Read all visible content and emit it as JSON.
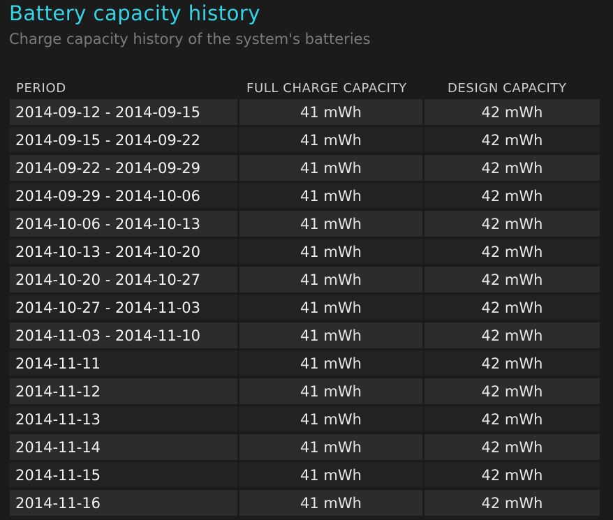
{
  "title": "Battery capacity history",
  "subtitle": "Charge capacity history of the system's batteries",
  "columns": {
    "period": "PERIOD",
    "full_charge_capacity": "FULL CHARGE CAPACITY",
    "design_capacity": "DESIGN CAPACITY"
  },
  "rows": [
    {
      "period": "2014-09-12 - 2014-09-15",
      "full": "41 mWh",
      "design": "42 mWh"
    },
    {
      "period": "2014-09-15 - 2014-09-22",
      "full": "41 mWh",
      "design": "42 mWh"
    },
    {
      "period": "2014-09-22 - 2014-09-29",
      "full": "41 mWh",
      "design": "42 mWh"
    },
    {
      "period": "2014-09-29 - 2014-10-06",
      "full": "41 mWh",
      "design": "42 mWh"
    },
    {
      "period": "2014-10-06 - 2014-10-13",
      "full": "41 mWh",
      "design": "42 mWh"
    },
    {
      "period": "2014-10-13 - 2014-10-20",
      "full": "41 mWh",
      "design": "42 mWh"
    },
    {
      "period": "2014-10-20 - 2014-10-27",
      "full": "41 mWh",
      "design": "42 mWh"
    },
    {
      "period": "2014-10-27 - 2014-11-03",
      "full": "41 mWh",
      "design": "42 mWh"
    },
    {
      "period": "2014-11-03 - 2014-11-10",
      "full": "41 mWh",
      "design": "42 mWh"
    },
    {
      "period": "2014-11-11",
      "full": "41 mWh",
      "design": "42 mWh"
    },
    {
      "period": "2014-11-12",
      "full": "41 mWh",
      "design": "42 mWh"
    },
    {
      "period": "2014-11-13",
      "full": "41 mWh",
      "design": "42 mWh"
    },
    {
      "period": "2014-11-14",
      "full": "41 mWh",
      "design": "42 mWh"
    },
    {
      "period": "2014-11-15",
      "full": "41 mWh",
      "design": "42 mWh"
    },
    {
      "period": "2014-11-16",
      "full": "41 mWh",
      "design": "42 mWh"
    }
  ],
  "colors": {
    "title": "#33d6e6",
    "subtitle": "#7b7b7b",
    "background": "#1b1b1b",
    "row_odd": "#2c2c2c",
    "row_even": "#222222"
  }
}
